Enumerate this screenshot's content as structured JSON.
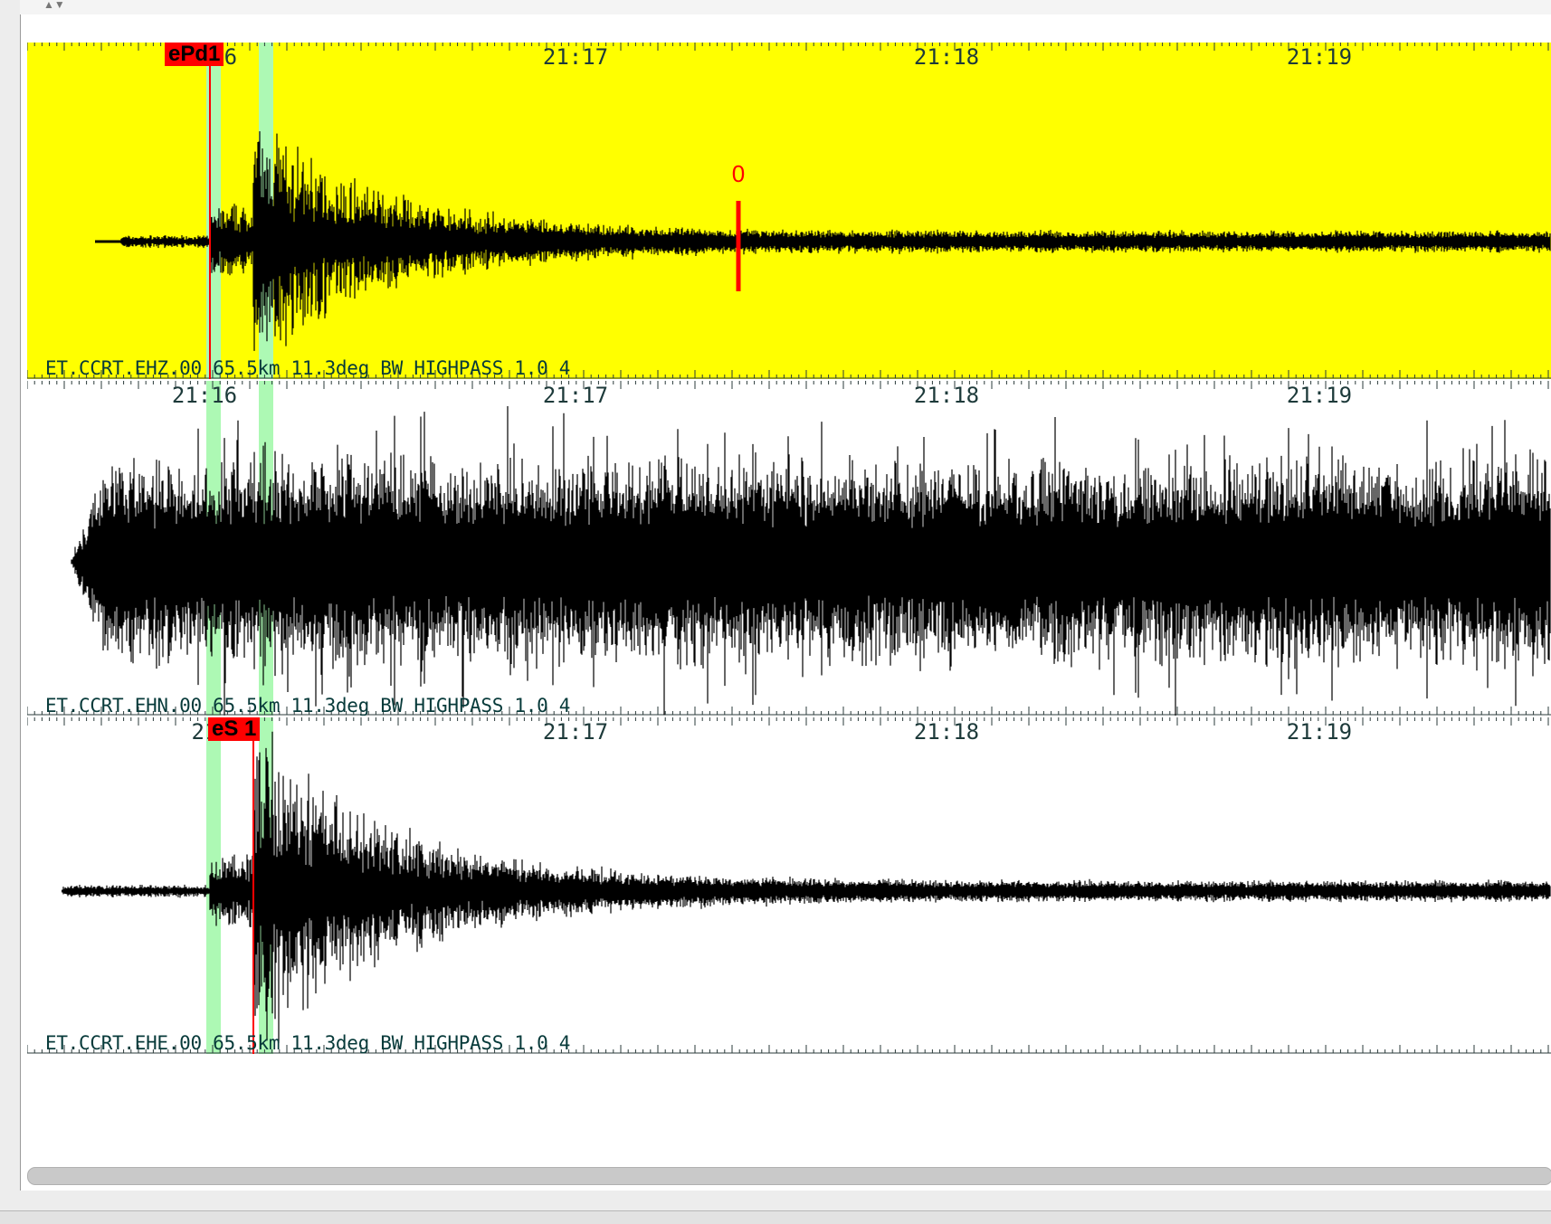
{
  "panels": [
    {
      "id": "ehz",
      "background": "#ffff00",
      "waveform": "decay",
      "time_labels": [
        "21:16",
        "21:17",
        "21:18",
        "21:19"
      ],
      "channel_label": "ET.CCRT.EHZ.00 65.5km 11.3deg BW HIGHPASS 1.0 4",
      "pick": {
        "label": "ePd1"
      },
      "marker": {
        "label": "0"
      }
    },
    {
      "id": "ehn",
      "background": "#ffffff",
      "waveform": "noise",
      "time_labels": [
        "21:16",
        "21:17",
        "21:18",
        "21:19"
      ],
      "channel_label": "ET.CCRT.EHN.00 65.5km 11.3deg BW HIGHPASS 1.0 4"
    },
    {
      "id": "ehe",
      "background": "#ffffff",
      "waveform": "decay",
      "time_labels": [
        "21",
        "21:17",
        "21:18",
        "21:19"
      ],
      "channel_label": "ET.CCRT.EHE.00 65.5km 11.3deg BW HIGHPASS 1.0 4",
      "pick": {
        "label": "eS 1"
      }
    }
  ],
  "colors": {
    "pick": "#ff0000",
    "highlight_band": "#adf9b4",
    "trace": "#000000",
    "text": "#073a3a"
  }
}
